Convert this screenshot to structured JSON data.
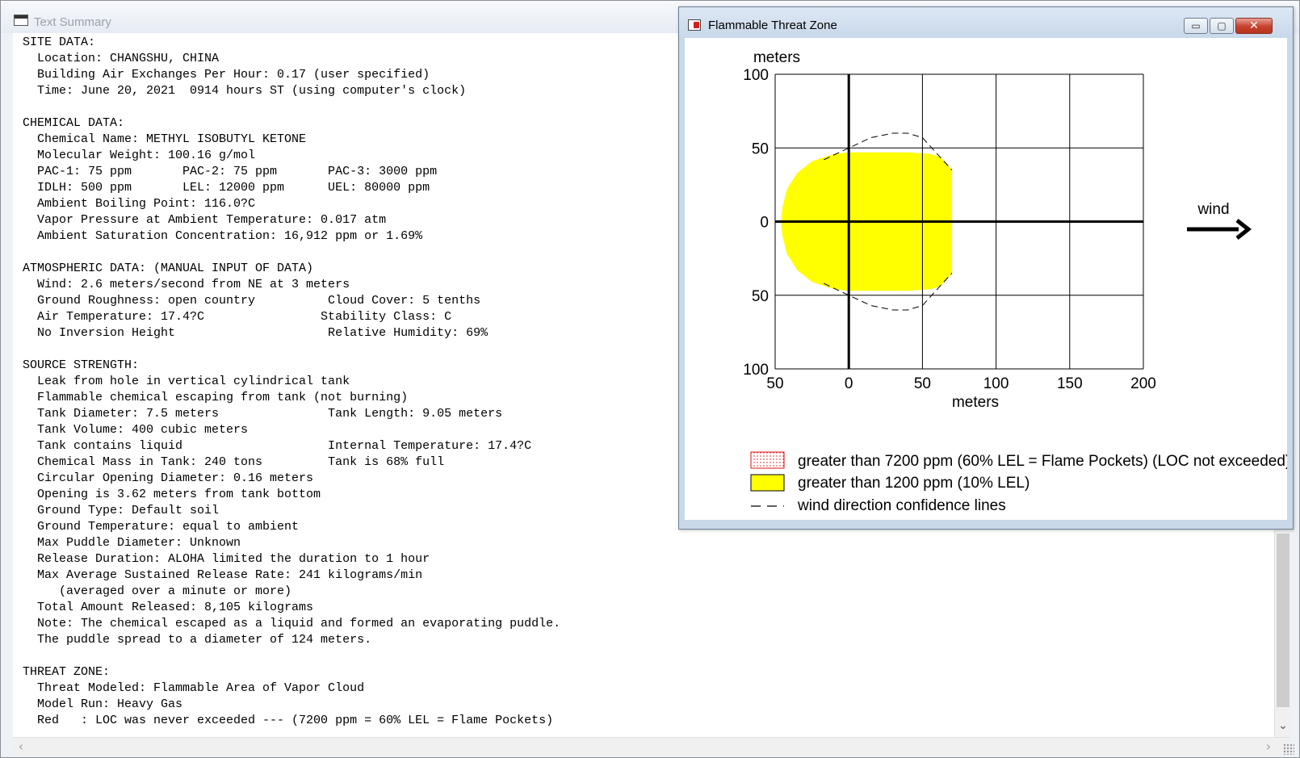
{
  "text_summary": {
    "title": "Text Summary",
    "lines": [
      "SITE DATA:",
      "  Location: CHANGSHU, CHINA",
      "  Building Air Exchanges Per Hour: 0.17 (user specified)",
      "  Time: June 20, 2021  0914 hours ST (using computer's clock)",
      "",
      "CHEMICAL DATA:",
      "  Chemical Name: METHYL ISOBUTYL KETONE",
      "  Molecular Weight: 100.16 g/mol",
      "  PAC-1: 75 ppm       PAC-2: 75 ppm       PAC-3: 3000 ppm",
      "  IDLH: 500 ppm       LEL: 12000 ppm      UEL: 80000 ppm",
      "  Ambient Boiling Point: 116.0?C",
      "  Vapor Pressure at Ambient Temperature: 0.017 atm",
      "  Ambient Saturation Concentration: 16,912 ppm or 1.69%",
      "",
      "ATMOSPHERIC DATA: (MANUAL INPUT OF DATA)",
      "  Wind: 2.6 meters/second from NE at 3 meters",
      "  Ground Roughness: open country          Cloud Cover: 5 tenths",
      "  Air Temperature: 17.4?C                Stability Class: C",
      "  No Inversion Height                     Relative Humidity: 69%",
      "",
      "SOURCE STRENGTH:",
      "  Leak from hole in vertical cylindrical tank",
      "  Flammable chemical escaping from tank (not burning)",
      "  Tank Diameter: 7.5 meters               Tank Length: 9.05 meters",
      "  Tank Volume: 400 cubic meters",
      "  Tank contains liquid                    Internal Temperature: 17.4?C",
      "  Chemical Mass in Tank: 240 tons         Tank is 68% full",
      "  Circular Opening Diameter: 0.16 meters",
      "  Opening is 3.62 meters from tank bottom",
      "  Ground Type: Default soil",
      "  Ground Temperature: equal to ambient",
      "  Max Puddle Diameter: Unknown",
      "  Release Duration: ALOHA limited the duration to 1 hour",
      "  Max Average Sustained Release Rate: 241 kilograms/min",
      "     (averaged over a minute or more)",
      "  Total Amount Released: 8,105 kilograms",
      "  Note: The chemical escaped as a liquid and formed an evaporating puddle.",
      "  The puddle spread to a diameter of 124 meters.",
      "",
      "THREAT ZONE:",
      "  Threat Modeled: Flammable Area of Vapor Cloud",
      "  Model Run: Heavy Gas",
      "  Red   : LOC was never exceeded --- (7200 ppm = 60% LEL = Flame Pockets)"
    ],
    "scroll_down_glyph": "⌄",
    "scroll_left_glyph": "‹",
    "scroll_right_glyph": "›"
  },
  "threat_zone_window": {
    "title": "Flammable Threat Zone",
    "min_glyph": "▭",
    "max_glyph": "▢",
    "close_glyph": "✕",
    "chart_data": {
      "type": "area",
      "x_axis": {
        "label": "meters",
        "range": [
          -50,
          200
        ],
        "ticks": [
          -50,
          0,
          50,
          100,
          150,
          200
        ],
        "tick_labels": [
          "50",
          "0",
          "50",
          "100",
          "150",
          "200"
        ]
      },
      "y_axis": {
        "label": "meters",
        "range": [
          -100,
          100
        ],
        "ticks": [
          100,
          50,
          0,
          -50,
          -100
        ],
        "tick_labels": [
          "100",
          "50",
          "0",
          "50",
          "100"
        ]
      },
      "grid": true,
      "wind_label": "wind",
      "wind_direction": "positive-x",
      "zones": [
        {
          "name": "greater than 1200 ppm (10% LEL)",
          "color": "#ffff00",
          "outline": [
            [
              -46,
              0
            ],
            [
              -45,
              10
            ],
            [
              -42,
              22
            ],
            [
              -35,
              33
            ],
            [
              -25,
              41
            ],
            [
              -10,
              46
            ],
            [
              0,
              47
            ],
            [
              20,
              47
            ],
            [
              40,
              47
            ],
            [
              55,
              46
            ],
            [
              62,
              44
            ],
            [
              70,
              35
            ],
            [
              70,
              20
            ],
            [
              70,
              0
            ],
            [
              70,
              -20
            ],
            [
              70,
              -35
            ],
            [
              62,
              -44
            ],
            [
              55,
              -46
            ],
            [
              40,
              -47
            ],
            [
              20,
              -47
            ],
            [
              0,
              -47
            ],
            [
              -10,
              -46
            ],
            [
              -25,
              -41
            ],
            [
              -35,
              -33
            ],
            [
              -42,
              -22
            ],
            [
              -45,
              -10
            ]
          ]
        }
      ],
      "confidence_lines": {
        "name": "wind direction confidence lines",
        "style": "dashed",
        "upper": [
          [
            -17,
            42
          ],
          [
            0,
            50
          ],
          [
            15,
            57
          ],
          [
            30,
            60
          ],
          [
            40,
            60
          ],
          [
            50,
            57
          ],
          [
            60,
            46
          ],
          [
            70,
            35
          ]
        ],
        "lower": [
          [
            -17,
            -42
          ],
          [
            0,
            -50
          ],
          [
            15,
            -57
          ],
          [
            30,
            -60
          ],
          [
            40,
            -60
          ],
          [
            50,
            -57
          ],
          [
            60,
            -46
          ],
          [
            70,
            -35
          ]
        ]
      },
      "legend": [
        {
          "label": "greater than 7200 ppm (60% LEL = Flame Pockets) (LOC not exceeded)",
          "swatch": "red-dotted"
        },
        {
          "label": "greater than 1200 ppm (10% LEL)",
          "swatch": "yellow"
        },
        {
          "label": "wind direction confidence lines",
          "swatch": "dashed-line"
        }
      ],
      "colors": {
        "zone_yellow": "#ffff00",
        "flame_red": "#e01010"
      }
    }
  }
}
